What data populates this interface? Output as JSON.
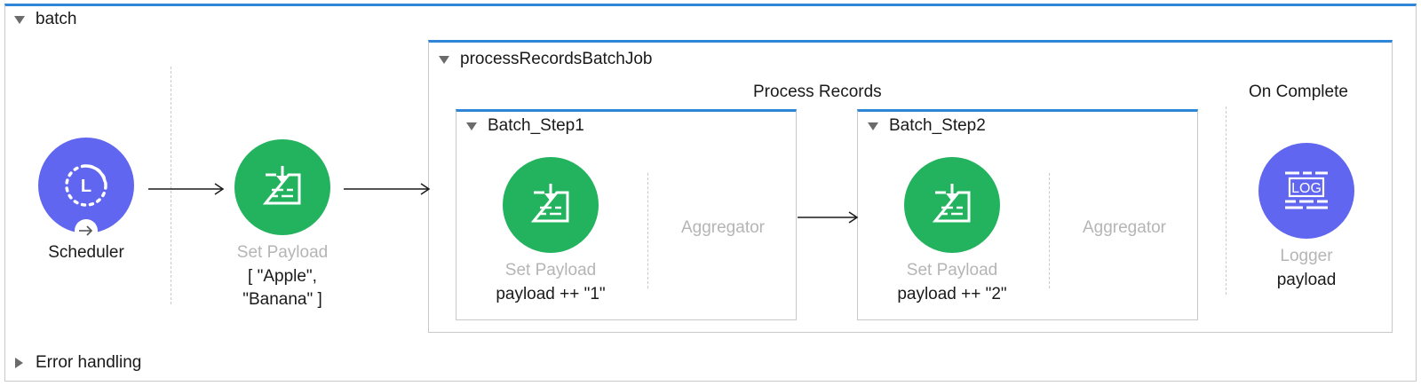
{
  "flow": {
    "name": "batch",
    "error_handling_label": "Error handling"
  },
  "batch_job": {
    "name": "processRecordsBatchJob",
    "process_records_label": "Process Records",
    "on_complete_label": "On Complete"
  },
  "scheduler": {
    "label": "Scheduler"
  },
  "set_payload_main": {
    "label": "Set Payload",
    "value_line1": "[ \"Apple\",",
    "value_line2": "\"Banana\" ]"
  },
  "steps": [
    {
      "name": "Batch_Step1",
      "processor_label": "Set Payload",
      "processor_value": "payload ++ \"1\"",
      "aggregator_label": "Aggregator"
    },
    {
      "name": "Batch_Step2",
      "processor_label": "Set Payload",
      "processor_value": "payload ++ \"2\"",
      "aggregator_label": "Aggregator"
    }
  ],
  "logger": {
    "label": "Logger",
    "value": "payload",
    "icon_text": "LOG"
  },
  "colors": {
    "accent_blue": "#2f86d6",
    "processor_green": "#23b35f",
    "source_purple": "#6166f0",
    "muted_label": "#b5b5b5"
  }
}
